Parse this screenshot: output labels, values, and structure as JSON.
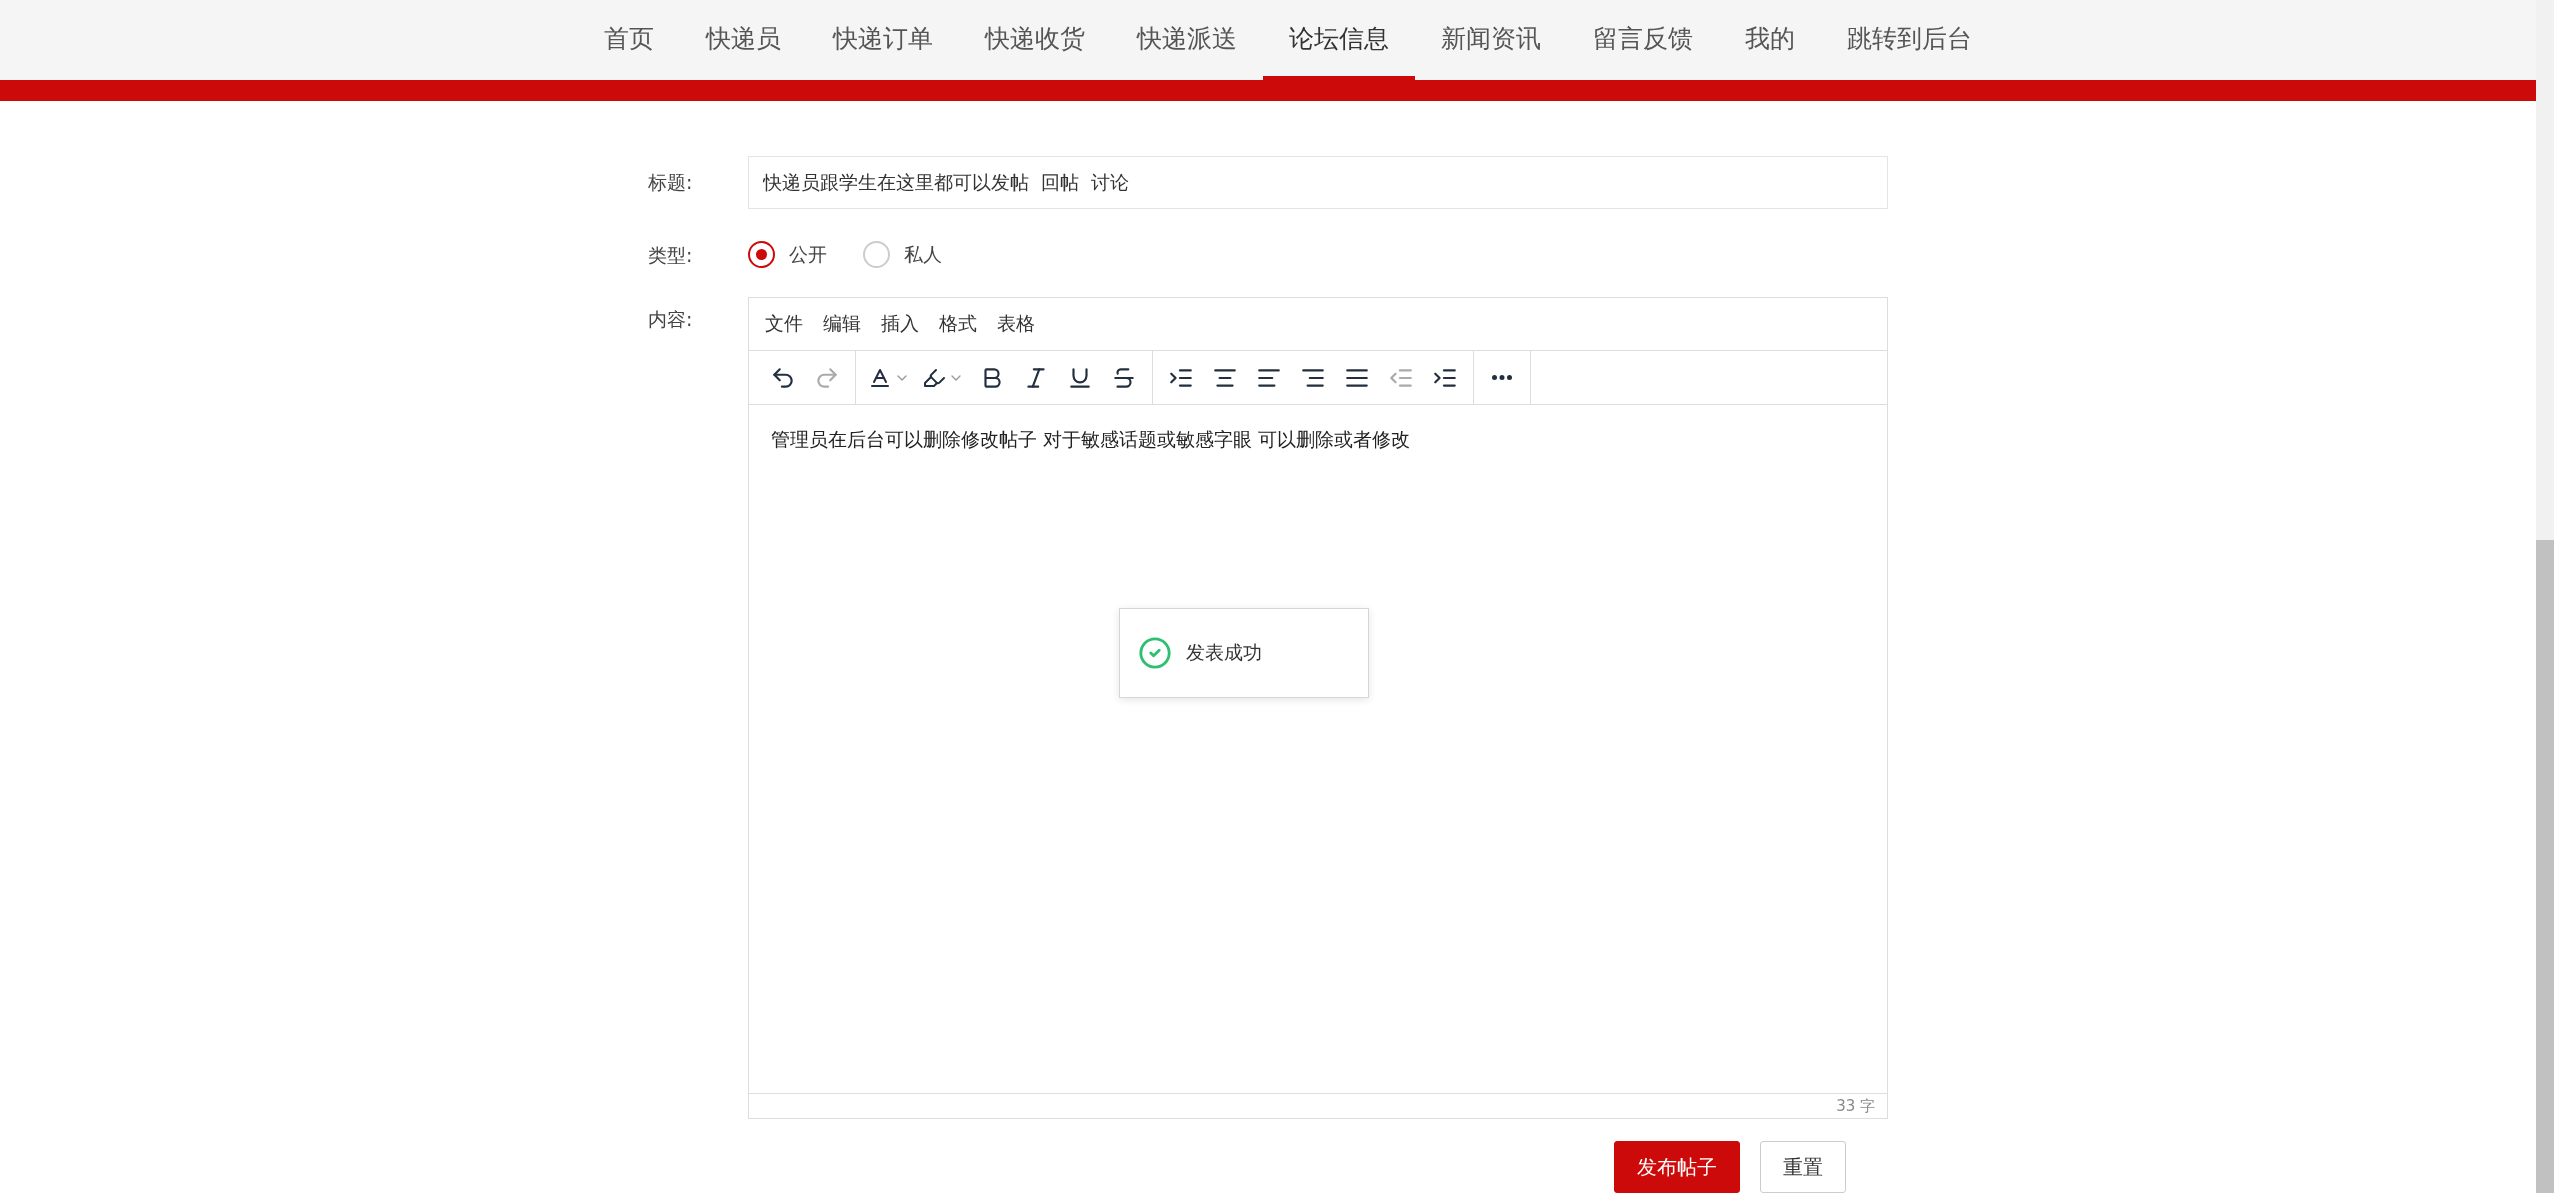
{
  "nav": [
    {
      "label": "首页",
      "selected": false
    },
    {
      "label": "快递员",
      "selected": false
    },
    {
      "label": "快递订单",
      "selected": false
    },
    {
      "label": "快递收货",
      "selected": false
    },
    {
      "label": "快递派送",
      "selected": false
    },
    {
      "label": "论坛信息",
      "selected": true
    },
    {
      "label": "新闻资讯",
      "selected": false
    },
    {
      "label": "留言反馈",
      "selected": false
    },
    {
      "label": "我的",
      "selected": false
    },
    {
      "label": "跳转到后台",
      "selected": false
    }
  ],
  "form": {
    "title_label": "标题:",
    "title_value": "快递员跟学生在这里都可以发帖  回帖  讨论",
    "type_label": "类型:",
    "type_options": [
      {
        "label": "公开",
        "selected": true
      },
      {
        "label": "私人",
        "selected": false
      }
    ],
    "content_label": "内容:"
  },
  "editor": {
    "menus": [
      "文件",
      "编辑",
      "插入",
      "格式",
      "表格"
    ],
    "tools": [
      {
        "kind": "undo",
        "disabled": false
      },
      {
        "kind": "redo",
        "disabled": true
      },
      {
        "kind": "font-color",
        "disabled": false
      },
      {
        "kind": "highlight",
        "disabled": false
      },
      {
        "kind": "bold",
        "disabled": false
      },
      {
        "kind": "italic",
        "disabled": false
      },
      {
        "kind": "underline",
        "disabled": false
      },
      {
        "kind": "strike",
        "disabled": false
      },
      {
        "kind": "list-indent",
        "disabled": false
      },
      {
        "kind": "align-center",
        "disabled": false
      },
      {
        "kind": "align-left",
        "disabled": false
      },
      {
        "kind": "align-right",
        "disabled": false
      },
      {
        "kind": "align-justify",
        "disabled": false
      },
      {
        "kind": "outdent",
        "disabled": true
      },
      {
        "kind": "indent",
        "disabled": false
      },
      {
        "kind": "more",
        "disabled": false
      }
    ],
    "body": "管理员在后台可以删除修改帖子 对于敏感话题或敏感字眼 可以删除或者修改",
    "word_count": "33 字"
  },
  "toast": {
    "message": "发表成功"
  },
  "buttons": [
    {
      "label": "发布帖子",
      "kind": "primary"
    },
    {
      "label": "重置",
      "kind": "plain"
    }
  ]
}
